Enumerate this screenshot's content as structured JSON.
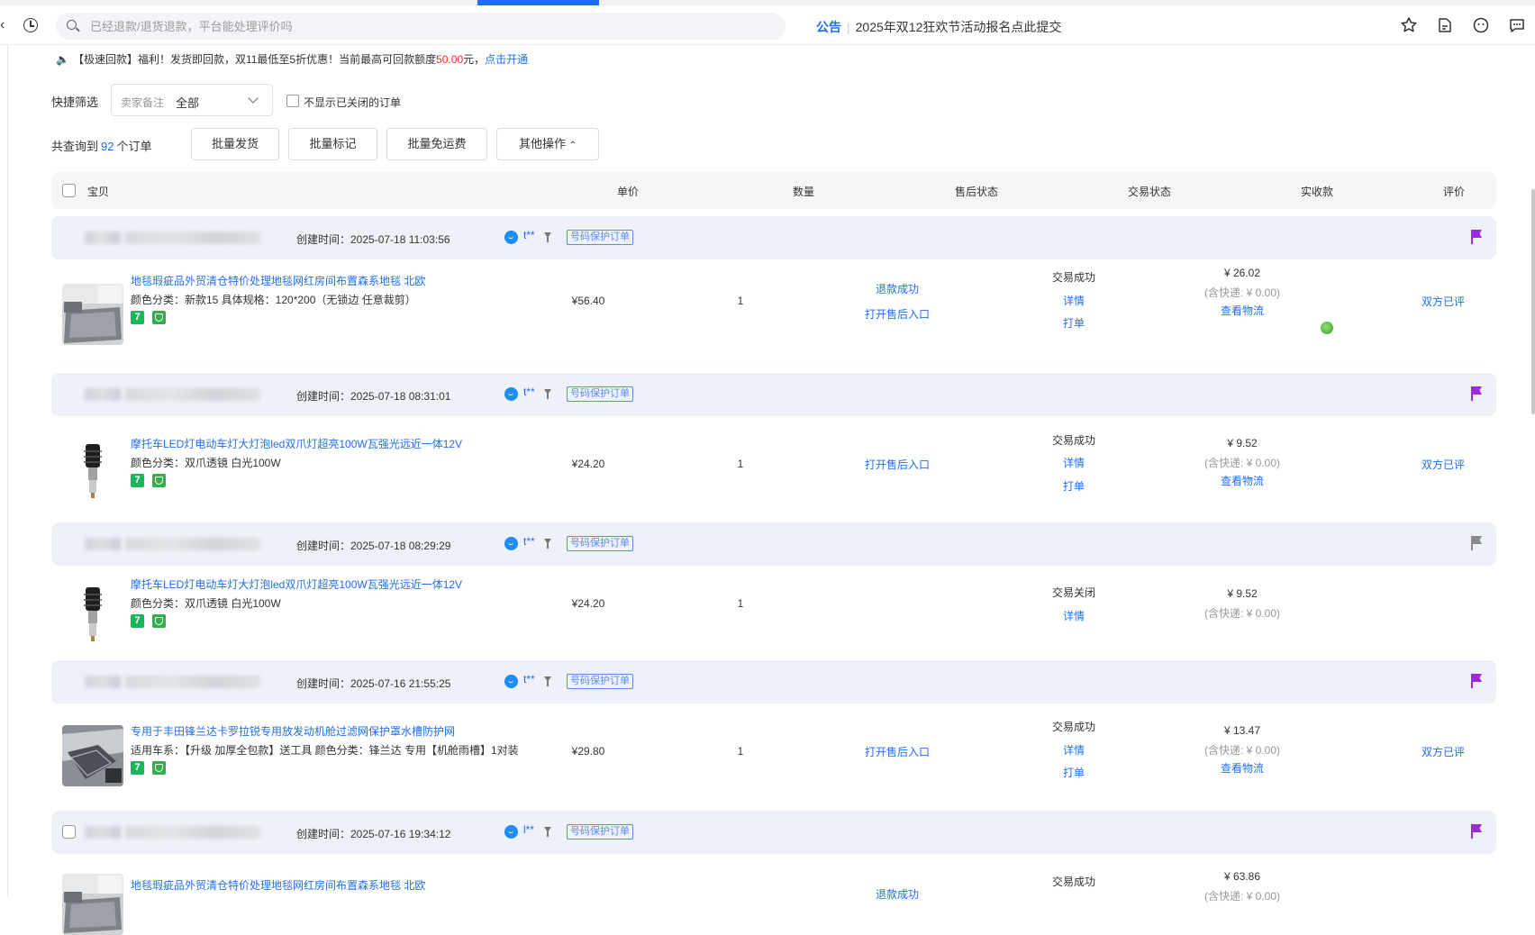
{
  "search": {
    "placeholder": "已经退款/退货退款，平台能处理评价吗"
  },
  "announcement": {
    "tag": "公告",
    "text": "2025年双12狂欢节活动报名点此提交"
  },
  "promo": {
    "prefix": "【极速回款】福利！发货即回款，双11最低至5折优惠！当前最高可回款额度",
    "amount": "50.00",
    "unit": "元，",
    "link": "点击开通"
  },
  "filter": {
    "label": "快捷筛选",
    "select_placeholder": "卖家备注",
    "select_value": "全部",
    "checkbox_label": "不显示已关闭的订单"
  },
  "summary": {
    "prefix": "共查询到",
    "count": "92",
    "suffix": "个订单"
  },
  "batch_buttons": [
    "批量发货",
    "批量标记",
    "批量免运费",
    "其他操作"
  ],
  "table_headers": {
    "item": "宝贝",
    "price": "单价",
    "qty": "数量",
    "aftersale": "售后状态",
    "trade": "交易状态",
    "received": "实收款",
    "review": "评价"
  },
  "orders": [
    {
      "created": "创建时间：2025-07-18 11:03:56",
      "buyer": "t**",
      "protect": "号码保护订单",
      "flag_color": "#9b2bd8",
      "title": "地毯瑕疵品外贸清仓特价处理地毯网红房间布置森系地毯 北欧",
      "spec": "颜色分类：新款15   具体规格：120*200（无锁边 任意裁剪）",
      "price": "¥56.40",
      "qty": "1",
      "aftersale": [
        "退款成功",
        "打开售后入口"
      ],
      "trade": [
        "交易成功",
        "详情",
        "打单"
      ],
      "received": "¥ 26.02",
      "shipping": "(含快递: ¥ 0.00)",
      "logistics": "查看物流",
      "review": "双方已评"
    },
    {
      "created": "创建时间：2025-07-18 08:31:01",
      "buyer": "t**",
      "protect": "号码保护订单",
      "flag_color": "#9b2bd8",
      "title": "摩托车LED灯电动车灯大灯泡led双爪灯超亮100W瓦强光远近一体12V",
      "spec": "颜色分类：双爪透镜 白光100W",
      "price": "¥24.20",
      "qty": "1",
      "aftersale": [
        "打开售后入口"
      ],
      "trade": [
        "交易成功",
        "详情",
        "打单"
      ],
      "received": "¥ 9.52",
      "shipping": "(含快递: ¥ 0.00)",
      "logistics": "查看物流",
      "review": "双方已评"
    },
    {
      "created": "创建时间：2025-07-18 08:29:29",
      "buyer": "t**",
      "protect": "号码保护订单",
      "flag_color": "#8a8a8a",
      "title": "摩托车LED灯电动车灯大灯泡led双爪灯超亮100W瓦强光远近一体12V",
      "spec": "颜色分类：双爪透镜 白光100W",
      "price": "¥24.20",
      "qty": "1",
      "aftersale": [],
      "trade": [
        "交易关闭",
        "详情"
      ],
      "received": "¥ 9.52",
      "shipping": "(含快递: ¥ 0.00)",
      "logistics": "",
      "review": ""
    },
    {
      "created": "创建时间：2025-07-16 21:55:25",
      "buyer": "t**",
      "protect": "号码保护订单",
      "flag_color": "#9b2bd8",
      "title": "专用于丰田锋兰达卡罗拉锐专用放发动机舱过滤网保护罩水槽防护网",
      "spec": "适用车系：【升级 加厚全包款】送工具   颜色分类：锋兰达 专用【机舱雨槽】1对装",
      "price": "¥29.80",
      "qty": "1",
      "aftersale": [
        "打开售后入口"
      ],
      "trade": [
        "交易成功",
        "详情",
        "打单"
      ],
      "received": "¥ 13.47",
      "shipping": "(含快递: ¥ 0.00)",
      "logistics": "查看物流",
      "review": "双方已评"
    },
    {
      "created": "创建时间：2025-07-16 19:34:12",
      "buyer": "l**",
      "protect": "号码保护订单",
      "flag_color": "#9b2bd8",
      "title": "地毯瑕疵品外贸清仓特价处理地毯网红房间布置森系地毯 北欧",
      "spec": "",
      "price": "",
      "qty": "",
      "aftersale": [
        "退款成功"
      ],
      "trade": [
        "交易成功"
      ],
      "received": "¥ 63.86",
      "shipping": "(含快递: ¥ 0.00)",
      "logistics": "",
      "review": ""
    }
  ],
  "colors": {
    "accent": "#1f6ff0",
    "flag_purple": "#9b2bd8",
    "flag_gray": "#8a8a8a",
    "header_bg": "#eef1f8"
  }
}
